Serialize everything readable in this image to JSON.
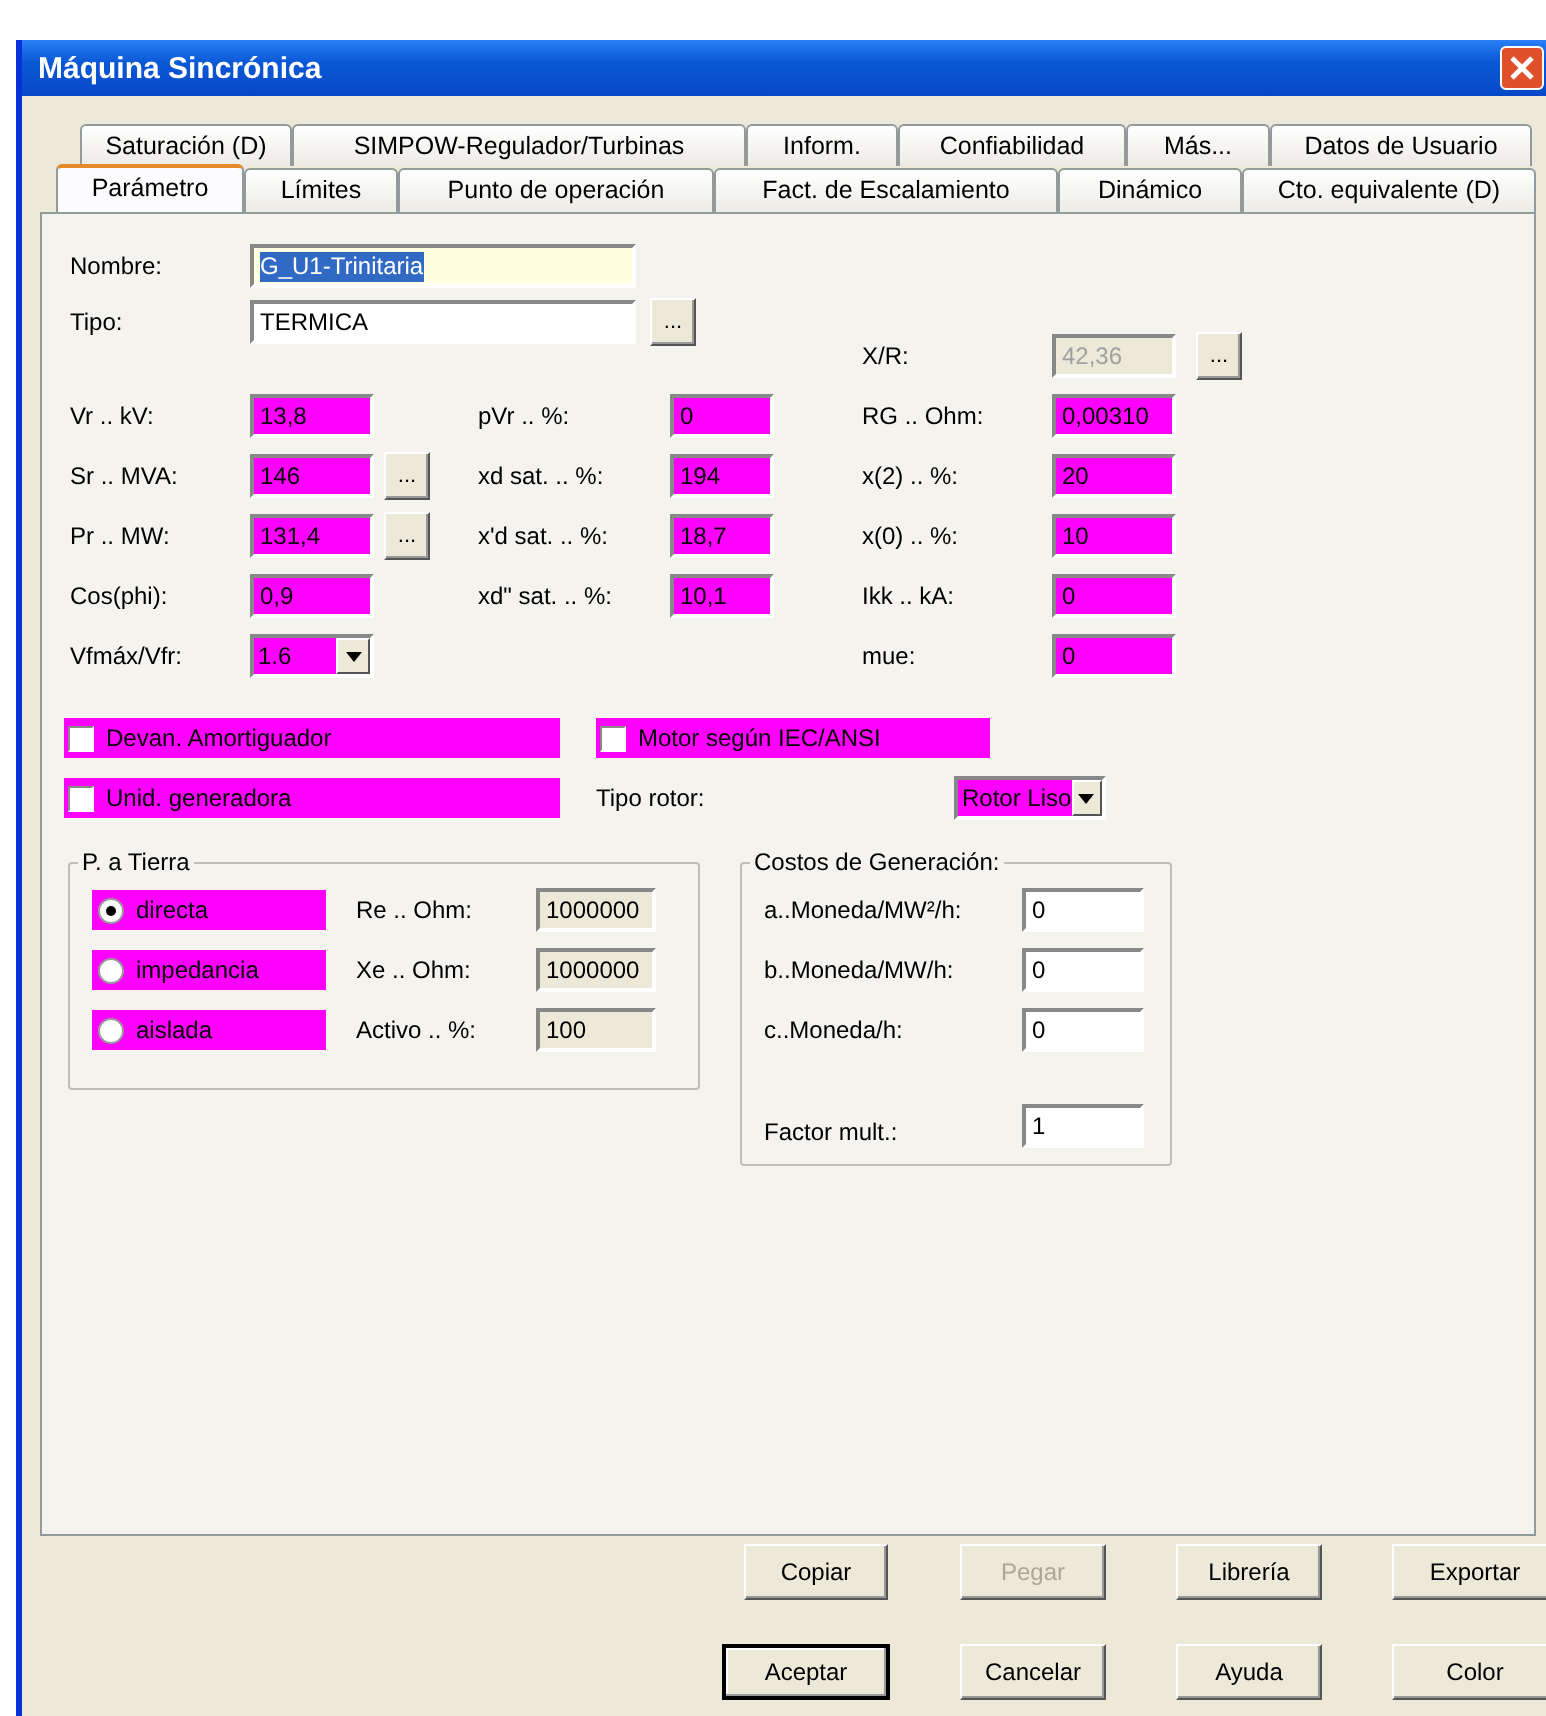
{
  "window": {
    "title": "Máquina Sincrónica"
  },
  "tab_rows": [
    [
      {
        "label": "Saturación (D)",
        "selected": false
      },
      {
        "label": "SIMPOW-Regulador/Turbinas",
        "selected": false
      },
      {
        "label": "Inform.",
        "selected": false
      },
      {
        "label": "Confiabilidad",
        "selected": false
      },
      {
        "label": "Más...",
        "selected": false
      },
      {
        "label": "Datos de Usuario",
        "selected": false
      }
    ],
    [
      {
        "label": "Parámetro",
        "selected": true
      },
      {
        "label": "Límites",
        "selected": false
      },
      {
        "label": "Punto de operación",
        "selected": false
      },
      {
        "label": "Fact. de Escalamiento",
        "selected": false
      },
      {
        "label": "Dinámico",
        "selected": false
      },
      {
        "label": "Cto. equivalente (D)",
        "selected": false
      }
    ]
  ],
  "name_field": {
    "label": "Nombre:",
    "value": "G_U1-Trinitaria",
    "text_selected": true
  },
  "type_field": {
    "label": "Tipo:",
    "value": "TERMICA",
    "button": "..."
  },
  "parameters": {
    "left": [
      {
        "label": "Vr .. kV:",
        "value": "13,8",
        "kind": "field",
        "highlighted": true
      },
      {
        "label": "Sr .. MVA:",
        "value": "146",
        "kind": "field",
        "button": "...",
        "highlighted": true
      },
      {
        "label": "Pr .. MW:",
        "value": "131,4",
        "kind": "field",
        "button": "...",
        "highlighted": true
      },
      {
        "label": "Cos(phi):",
        "value": "0,9",
        "kind": "field",
        "highlighted": true
      },
      {
        "label": "Vfmáx/Vfr:",
        "value": "1.6",
        "kind": "dropdown",
        "highlighted": true
      }
    ],
    "middle": [
      {
        "label": "pVr .. %:",
        "value": "0",
        "kind": "field",
        "highlighted": true
      },
      {
        "label": "xd sat. .. %:",
        "value": "194",
        "kind": "field",
        "highlighted": true
      },
      {
        "label": "x'd sat. .. %:",
        "value": "18,7",
        "kind": "field",
        "highlighted": true
      },
      {
        "label": "xd\" sat. .. %:",
        "value": "10,1",
        "kind": "field",
        "highlighted": true
      }
    ],
    "right": [
      {
        "label": "X/R:",
        "value": "42,36",
        "kind": "field",
        "button": "...",
        "highlighted": false,
        "disabled": true
      },
      {
        "label": "RG .. Ohm:",
        "value": "0,00310",
        "kind": "field",
        "highlighted": true
      },
      {
        "label": "x(2) .. %:",
        "value": "20",
        "kind": "field",
        "highlighted": true
      },
      {
        "label": "x(0) .. %:",
        "value": "10",
        "kind": "field",
        "highlighted": true
      },
      {
        "label": "Ikk .. kA:",
        "value": "0",
        "kind": "field",
        "highlighted": true
      },
      {
        "label": "mue:",
        "value": "0",
        "kind": "field",
        "highlighted": true
      }
    ]
  },
  "checkboxes": [
    {
      "label": "Devan. Amortiguador",
      "checked": false,
      "highlighted": true
    },
    {
      "label": "Motor según IEC/ANSI",
      "checked": false,
      "highlighted": true
    },
    {
      "label": "Unid. generadora",
      "checked": false,
      "highlighted": true
    }
  ],
  "rotor": {
    "label": "Tipo rotor:",
    "value": "Rotor Liso",
    "highlighted": true
  },
  "grounding": {
    "title": "P. a Tierra",
    "options": [
      {
        "label": "directa",
        "selected": true,
        "highlighted": true
      },
      {
        "label": "impedancia",
        "selected": false,
        "highlighted": true
      },
      {
        "label": "aislada",
        "selected": false,
        "highlighted": true
      }
    ],
    "fields": [
      {
        "label": "Re .. Ohm:",
        "value": "1000000",
        "read_only": true
      },
      {
        "label": "Xe .. Ohm:",
        "value": "1000000",
        "read_only": true
      },
      {
        "label": "Activo .. %:",
        "value": "100",
        "read_only": true
      }
    ]
  },
  "costs": {
    "title": "Costos de Generación:",
    "fields": [
      {
        "label": "a..Moneda/MW²/h:",
        "value": "0",
        "read_only": false
      },
      {
        "label": "b..Moneda/MW/h:",
        "value": "0",
        "read_only": false
      },
      {
        "label": "c..Moneda/h:",
        "value": "0",
        "read_only": false
      },
      {
        "label": "Factor mult.:",
        "value": "1",
        "read_only": false
      }
    ]
  },
  "buttons": [
    [
      {
        "label": "Copiar",
        "disabled": false,
        "default": false
      },
      {
        "label": "Pegar",
        "disabled": true,
        "default": false
      },
      {
        "label": "Librería",
        "disabled": false,
        "default": false
      },
      {
        "label": "Exportar",
        "disabled": false,
        "default": false
      }
    ],
    [
      {
        "label": "Aceptar",
        "disabled": false,
        "default": true
      },
      {
        "label": "Cancelar",
        "disabled": false,
        "default": false
      },
      {
        "label": "Ayuda",
        "disabled": false,
        "default": false
      },
      {
        "label": "Color",
        "disabled": false,
        "default": false
      }
    ]
  ]
}
